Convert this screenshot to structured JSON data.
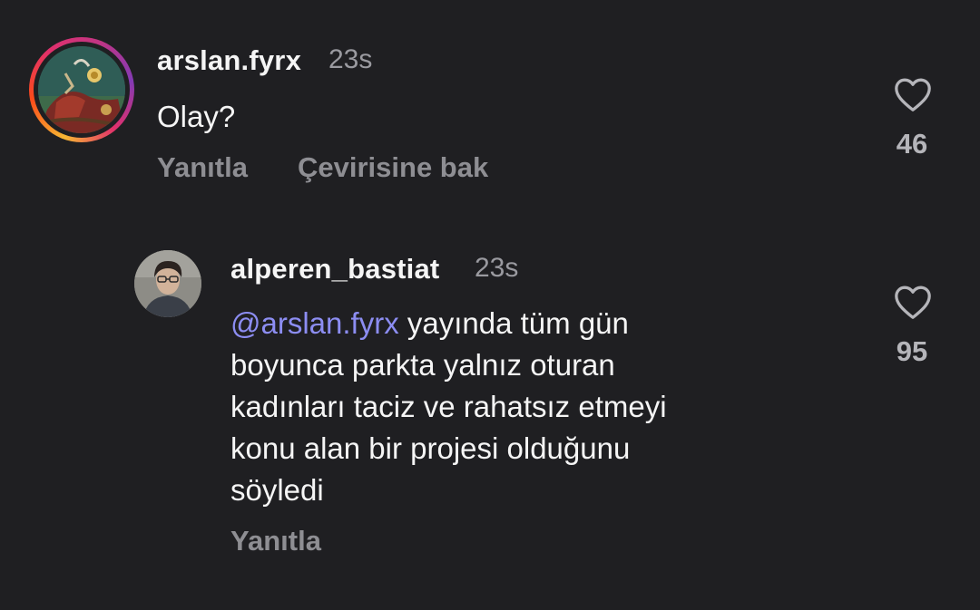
{
  "comments": [
    {
      "username": "arslan.fyrx",
      "time": "23s",
      "text": "Olay?",
      "actions": {
        "reply": "Yanıtla",
        "translate": "Çevirisine bak"
      },
      "likes": "46"
    }
  ],
  "reply": {
    "username": "alperen_bastiat",
    "time": "23s",
    "mention": "@arslan.fyrx",
    "text_lines": [
      " yayında tüm gün",
      "boyunca parkta yalnız oturan",
      "kadınları taciz ve rahatsız etmeyi",
      "konu alan bir projesi olduğunu",
      "söyledi"
    ],
    "actions": {
      "reply": "Yanıtla"
    },
    "likes": "95"
  },
  "colors": {
    "background": "#1f1f22",
    "mention": "#8c8df2",
    "muted": "#8e8e93"
  },
  "icons": {
    "like": "heart-outline-icon",
    "mention_prefix": "threads-at-icon"
  }
}
